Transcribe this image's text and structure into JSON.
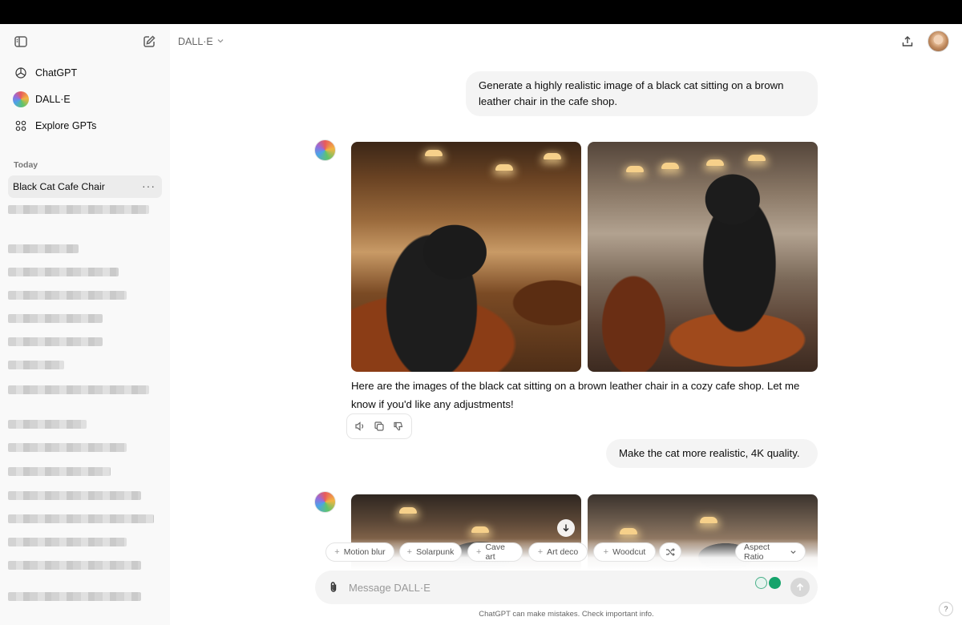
{
  "sidebar": {
    "nav": [
      {
        "label": "ChatGPT",
        "icon": "openai-logo-icon"
      },
      {
        "label": "DALL·E",
        "icon": "dalle-logo-icon"
      },
      {
        "label": "Explore GPTs",
        "icon": "grid-icon"
      }
    ],
    "section_today": "Today",
    "active_chat": "Black Cat Cafe Chair"
  },
  "header": {
    "model": "DALL·E"
  },
  "conversation": {
    "user_message_1": "Generate a highly realistic image of a black cat sitting on a brown leather chair in the cafe shop.",
    "assistant_message_1": "Here are the images of the black cat sitting on a brown leather chair in a cozy cafe shop. Let me know if you'd like any adjustments!",
    "user_message_2": "Make the cat more realistic, 4K quality."
  },
  "style_chips": [
    "Motion blur",
    "Solarpunk",
    "Cave art",
    "Art deco",
    "Woodcut"
  ],
  "aspect_ratio_label": "Aspect Ratio",
  "composer": {
    "placeholder": "Message DALL·E"
  },
  "disclaimer": "ChatGPT can make mistakes. Check important info.",
  "help_label": "?"
}
